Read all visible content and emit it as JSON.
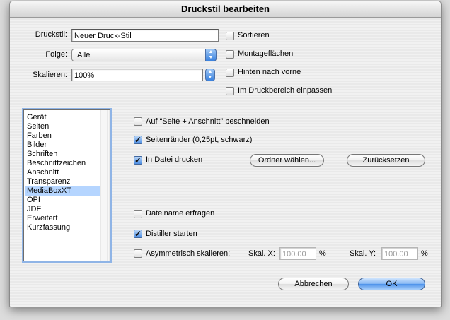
{
  "window": {
    "title": "Druckstil bearbeiten"
  },
  "form": {
    "druckstil_label": "Druckstil:",
    "druckstil_value": "Neuer Druck-Stil",
    "folge_label": "Folge:",
    "folge_value": "Alle",
    "skalieren_label": "Skalieren:",
    "skalieren_value": "100%"
  },
  "options_top": {
    "sortieren": {
      "label": "Sortieren",
      "checked": false
    },
    "montage": {
      "label": "Montageflächen",
      "checked": false
    },
    "hinten": {
      "label": "Hinten nach vorne",
      "checked": false
    },
    "einpassen": {
      "label": "Im Druckbereich einpassen",
      "checked": false
    }
  },
  "sidebar": {
    "items": [
      "Gerät",
      "Seiten",
      "Farben",
      "Bilder",
      "Schriften",
      "Beschnittzeichen",
      "Anschnitt",
      "Transparenz",
      "MediaBoxXT",
      "OPI",
      "JDF",
      "Erweitert",
      "Kurzfassung"
    ],
    "selected": "MediaBoxXT"
  },
  "panel": {
    "beschneiden": {
      "label": "Auf “Seite + Anschnitt” beschneiden",
      "checked": false
    },
    "seitenraender": {
      "label": "Seitenränder (0,25pt, schwarz)",
      "checked": true
    },
    "in_datei": {
      "label": "In Datei drucken",
      "checked": true
    },
    "ordner_button": "Ordner wählen...",
    "zuruecksetzen_button": "Zurücksetzen",
    "dateiname": {
      "label": "Dateiname erfragen",
      "checked": false
    },
    "distiller": {
      "label": "Distiller starten",
      "checked": true
    },
    "asymmetrisch": {
      "label": "Asymmetrisch skalieren:",
      "checked": false
    },
    "skal_x_label": "Skal. X:",
    "skal_x_value": "100.00",
    "skal_x_unit": "%",
    "skal_y_label": "Skal. Y:",
    "skal_y_value": "100.00",
    "skal_y_unit": "%"
  },
  "footer": {
    "cancel": "Abbrechen",
    "ok": "OK"
  }
}
